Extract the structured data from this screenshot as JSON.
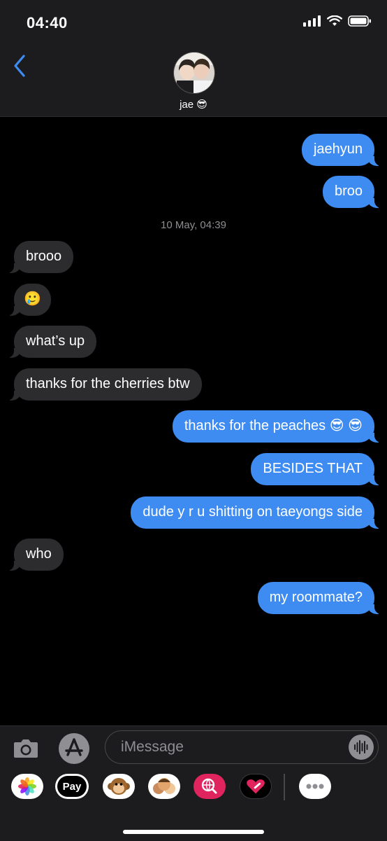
{
  "status_bar": {
    "time": "04:40",
    "icons": [
      "signal-icon",
      "wifi-icon",
      "battery-icon"
    ]
  },
  "header": {
    "back_icon": "chevron-left-icon",
    "contact_name": "jae 😎"
  },
  "thread": {
    "timestamp": "10 May, 04:39",
    "messages": [
      {
        "side": "out",
        "text": "jaehyun"
      },
      {
        "side": "out",
        "text": "broo"
      },
      {
        "side": "in",
        "text": "brooo"
      },
      {
        "side": "in",
        "text": "🥲"
      },
      {
        "side": "in",
        "text": "what’s up"
      },
      {
        "side": "in",
        "text": "thanks for the cherries btw"
      },
      {
        "side": "out",
        "text": "thanks for the peaches 😎 😎"
      },
      {
        "side": "out",
        "text": "BESIDES THAT"
      },
      {
        "side": "out",
        "text": "dude y r u shitting on taeyongs side"
      },
      {
        "side": "in",
        "text": "who"
      },
      {
        "side": "out",
        "text": "my roommate?"
      }
    ]
  },
  "composer": {
    "placeholder": "iMessage",
    "app_drawer": [
      {
        "name": "photos-app-icon"
      },
      {
        "name": "apple-pay-app-icon",
        "label": "Pay"
      },
      {
        "name": "animoji-app-icon"
      },
      {
        "name": "memoji-app-icon"
      },
      {
        "name": "image-search-app-icon"
      },
      {
        "name": "digital-touch-app-icon"
      },
      {
        "name": "more-apps-icon"
      }
    ]
  },
  "colors": {
    "outgoing": "#3e8cf2",
    "incoming": "#2c2c2e",
    "accent": "#3e8cf2"
  }
}
